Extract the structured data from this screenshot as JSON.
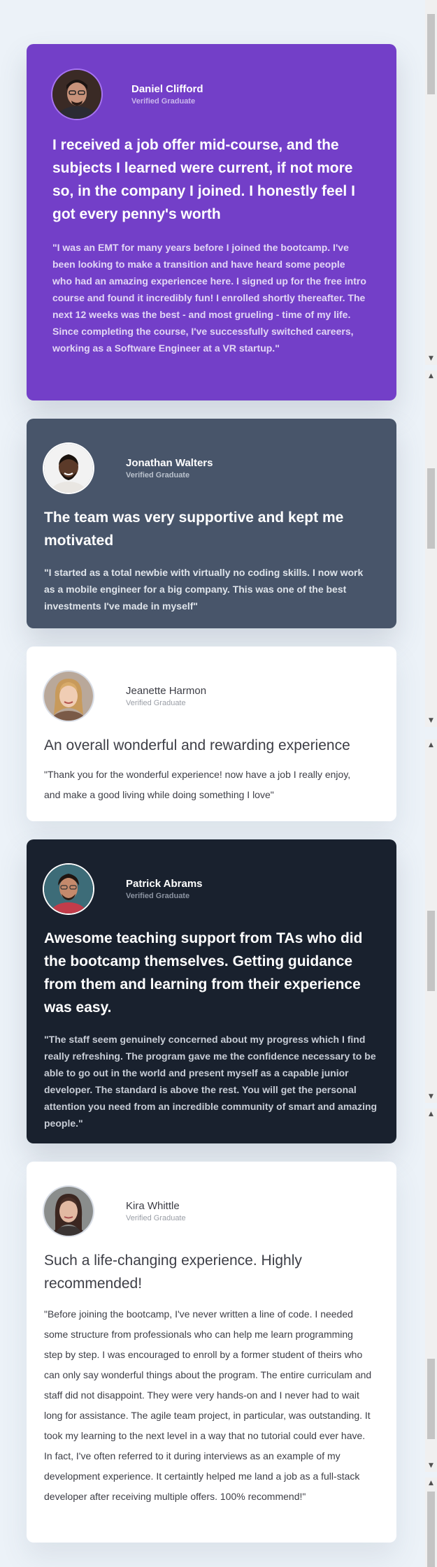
{
  "testimonials": [
    {
      "name": "Daniel Clifford",
      "status": "Verified Graduate",
      "headline": "I received a job offer mid-course, and the subjects I learned were current, if not more so, in the company I joined. I honestly feel I got every penny's worth",
      "quote": "\"I was an EMT for many years before I joined the bootcamp. I've been looking to make a transition and have heard some people who had an amazing experiencee here. I signed up for the free intro course and found it incredibly fun! I enrolled shortly thereafter. The next 12 weeks was the best - and most grueling - time of my life. Since completing the course, I've successfully switched careers, working as a Software Engineer at a VR startup.\"",
      "avatar_icon": "portrait-daniel",
      "bg_color": "#733FC8"
    },
    {
      "name": "Jonathan Walters",
      "status": "Verified Graduate",
      "headline": "The team was very supportive and kept me motivated",
      "quote": "\"I started as a total newbie with virtually no coding skills. I now work as a mobile engineer for a big company. This was one of the best investments I've made in myself\"",
      "avatar_icon": "portrait-jonathan",
      "bg_color": "#48556A"
    },
    {
      "name": "Jeanette Harmon",
      "status": "Verified Graduate",
      "headline": "An overall wonderful and rewarding experience",
      "quote": "\"Thank you for the wonderful experience! now have a job I really enjoy, and make a good living while doing something I love\"",
      "avatar_icon": "portrait-jeanette",
      "bg_color": "#FFFFFF"
    },
    {
      "name": "Patrick Abrams",
      "status": "Verified Graduate",
      "headline": "Awesome teaching support from TAs who did the bootcamp themselves. Getting guidance from them and learning from their experience was easy.",
      "quote": "\"The staff seem genuinely concerned about my progress which I find really refreshing. The program gave me the confidence necessary to be able to go out in the world and present myself as a capable junior developer. The standard is above the rest. You will get the personal attention you need from an incredible community of smart and amazing people.\"",
      "avatar_icon": "portrait-patrick",
      "bg_color": "#19212E"
    },
    {
      "name": "Kira Whittle",
      "status": "Verified Graduate",
      "headline": "Such a life-changing experience. Highly recommended!",
      "quote": "\"Before joining the bootcamp, I've never written a line of code. I needed some structure from professionals who can help me learn programming step by step. I was encouraged to enroll by a former student of theirs who can only say wonderful things about the program. The entire curriculam and staff did not disappoint. They were very hands-on and I never had to wait long for assistance. The agile team project, in particular, was outstanding. It took my learning to the next level in a way that no tutorial could ever have. In fact, I've often referred to it during interviews as an example of my development experience. It certaintly helped me land a job as a full-stack developer after receiving multiple offers. 100% recommend!\"",
      "avatar_icon": "portrait-kira",
      "bg_color": "#FFFFFF"
    }
  ],
  "scrollbars": {
    "arrow_up_icon": "arrow-up-icon",
    "arrow_down_icon": "arrow-down-icon",
    "track_color": "#F0F0F0",
    "thumb_color": "#C4C4C4"
  },
  "page_background": "#ECF2F8"
}
